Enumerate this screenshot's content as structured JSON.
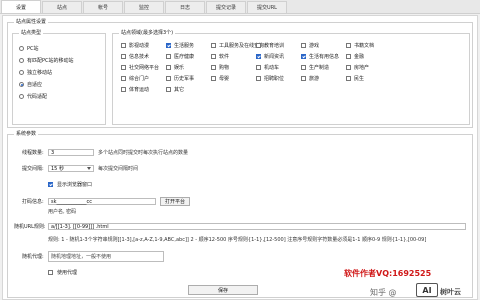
{
  "tabs": [
    "设置",
    "站点",
    "帐号",
    "监控",
    "日志",
    "提交记录",
    "提交URL"
  ],
  "site_settings": {
    "title": "站点属性设置",
    "site_type": {
      "title": "站点类型",
      "options": [
        "PC站",
        "有匹配PC站的移动站",
        "独立移动站",
        "自适应",
        "代码适配"
      ],
      "selected_index": 3
    },
    "site_domain": {
      "title": "站点领域(最多选择3个)",
      "items": [
        {
          "label": "影视动漫",
          "checked": false
        },
        {
          "label": "生活服务",
          "checked": true
        },
        {
          "label": "工具服务及在线查询",
          "checked": false
        },
        {
          "label": "教育培训",
          "checked": false
        },
        {
          "label": "游戏",
          "checked": false
        },
        {
          "label": "书籍文档",
          "checked": false
        },
        {
          "label": "信息技术",
          "checked": false
        },
        {
          "label": "医疗健康",
          "checked": false
        },
        {
          "label": "软件",
          "checked": false
        },
        {
          "label": "新闻资讯",
          "checked": true
        },
        {
          "label": "生活有用信息",
          "checked": true
        },
        {
          "label": "金融",
          "checked": false
        },
        {
          "label": "社交网络平台",
          "checked": false
        },
        {
          "label": "娱乐",
          "checked": false
        },
        {
          "label": "购物",
          "checked": false
        },
        {
          "label": "机动车",
          "checked": false
        },
        {
          "label": "生产制造",
          "checked": false
        },
        {
          "label": "房地产",
          "checked": false
        },
        {
          "label": "综合门户",
          "checked": false
        },
        {
          "label": "历史军事",
          "checked": false
        },
        {
          "label": "母婴",
          "checked": false
        },
        {
          "label": "招聘职位",
          "checked": false
        },
        {
          "label": "旅游",
          "checked": false
        },
        {
          "label": "民生",
          "checked": false
        },
        {
          "label": "体育运动",
          "checked": false
        },
        {
          "label": "其它",
          "checked": false
        }
      ]
    }
  },
  "system": {
    "title": "系统参数",
    "threads_label": "线程数量:",
    "threads_value": "3",
    "threads_hint": "多个站点同时提交时每次执行站点的数量",
    "interval_label": "提交间隔:",
    "interval_value": "15 秒",
    "interval_hint": "每次提交间隔时间",
    "show_browser_label": "显示浏览器窗口",
    "show_browser_checked": true,
    "platform_label": "打码信息:",
    "platform_value": "sk____________cc",
    "platform_button": "打开平台",
    "platform_hint": "用户名, 密码",
    "random_url_label": "随机URL规则:",
    "random_url_value": "a/[[1-3]. [[0-99]]]  .html",
    "random_url_rule": "规则: 1 - 随机1-3个字符串规则[[1-3],[a-z,A-Z,1-9,ABC,abc]]  2 - 顺序12-500 序号规则{1-1},[12-500] 注意序号规则字符数量必须是1-1 顺序0-9 规则{1-1},[00-09]",
    "proxy_label": "随机代理:",
    "proxy_placeholder": "随机地理地址，一般不使用",
    "use_proxy_label": "使用代理",
    "use_proxy_checked": false,
    "save_button": "保存"
  },
  "watermark": {
    "author": "软件作者VQ:1692525",
    "site": "知乎 @",
    "logo": "AI",
    "brand": "树叶云"
  }
}
